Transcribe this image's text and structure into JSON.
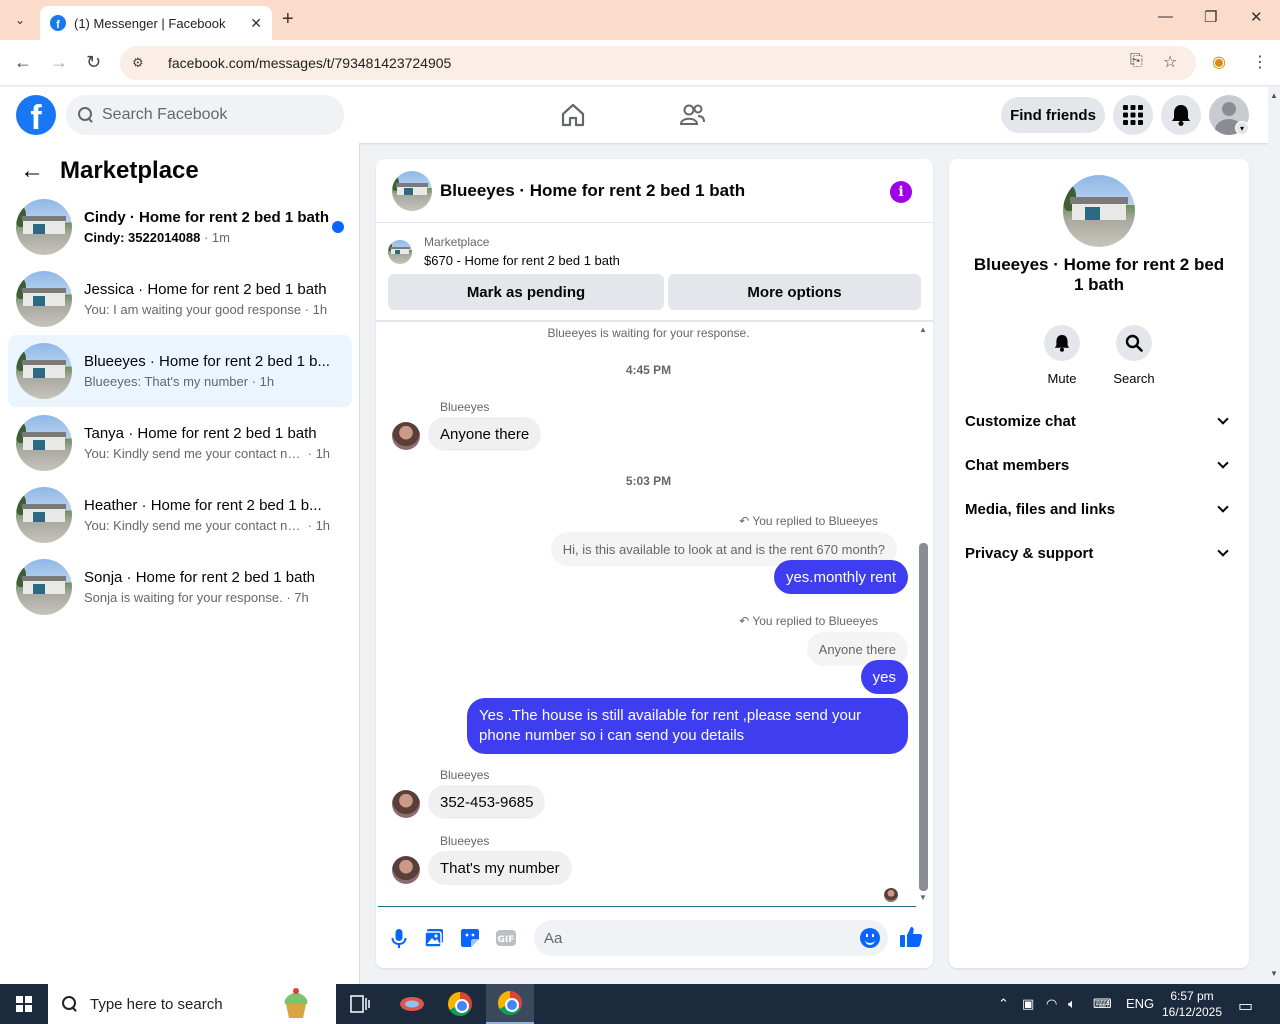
{
  "browser": {
    "tab_title": "(1) Messenger | Facebook",
    "url": "facebook.com/messages/t/793481423724905"
  },
  "fb": {
    "search_placeholder": "Search Facebook",
    "find_friends": "Find friends"
  },
  "left": {
    "title": "Marketplace",
    "conversations": [
      {
        "name": "Cindy · Home for rent 2 bed 1 bath",
        "preview": "Cindy: 3522014088",
        "time": "1m",
        "unread": true
      },
      {
        "name": "Jessica · Home for rent 2 bed 1 bath",
        "preview": "You: I am waiting your good response",
        "time": "1h",
        "unread": false
      },
      {
        "name": "Blueeyes · Home for rent 2 bed 1 b...",
        "preview": "Blueeyes: That's my number",
        "time": "1h",
        "unread": false,
        "active": true
      },
      {
        "name": "Tanya · Home for rent 2 bed 1 bath",
        "preview": "You: Kindly send me your contact nu...",
        "time": "1h",
        "unread": false
      },
      {
        "name": "Heather · Home for rent 2 bed 1 b...",
        "preview": "You: Kindly send me your contact nu...",
        "time": "1h",
        "unread": false
      },
      {
        "name": "Sonja · Home for rent 2 bed 1 bath",
        "preview": "Sonja is waiting for your response.",
        "time": "7h",
        "unread": false
      }
    ]
  },
  "chat": {
    "title": "Blueeyes · Home for rent 2 bed 1 bath",
    "marketplace_label": "Marketplace",
    "listing": "$670 - Home for rent 2 bed 1 bath",
    "btn_pending": "Mark as pending",
    "btn_more": "More options",
    "waiting_note": "Blueeyes is waiting for your response.",
    "time1": "4:45 PM",
    "time2": "5:03 PM",
    "sender": "Blueeyes",
    "msg_anyone": "Anyone there",
    "reply_note": "You replied to Blueeyes",
    "quote1": "Hi, is this available to look at and is the rent 670 month?",
    "out1": "yes.monthly rent",
    "quote2": "Anyone there",
    "out2": "yes",
    "out3": "Yes .The house is still available for rent ,please send your phone number so i can send you details",
    "msg_phone": "352-453-9685",
    "msg_number": "That's my number",
    "input_placeholder": "Aa"
  },
  "right": {
    "title": "Blueeyes · Home for rent 2 bed 1 bath",
    "mute": "Mute",
    "search": "Search",
    "sections": [
      "Customize chat",
      "Chat members",
      "Media, files and links",
      "Privacy & support"
    ]
  },
  "taskbar": {
    "search_placeholder": "Type here to search",
    "lang": "ENG",
    "time": "6:57 pm",
    "date": "16/12/2025"
  },
  "colors": {
    "fb_blue": "#1877f2",
    "bubble_out": "#3f3df0",
    "unread_dot": "#0866ff",
    "info_icon": "#a000e8"
  }
}
